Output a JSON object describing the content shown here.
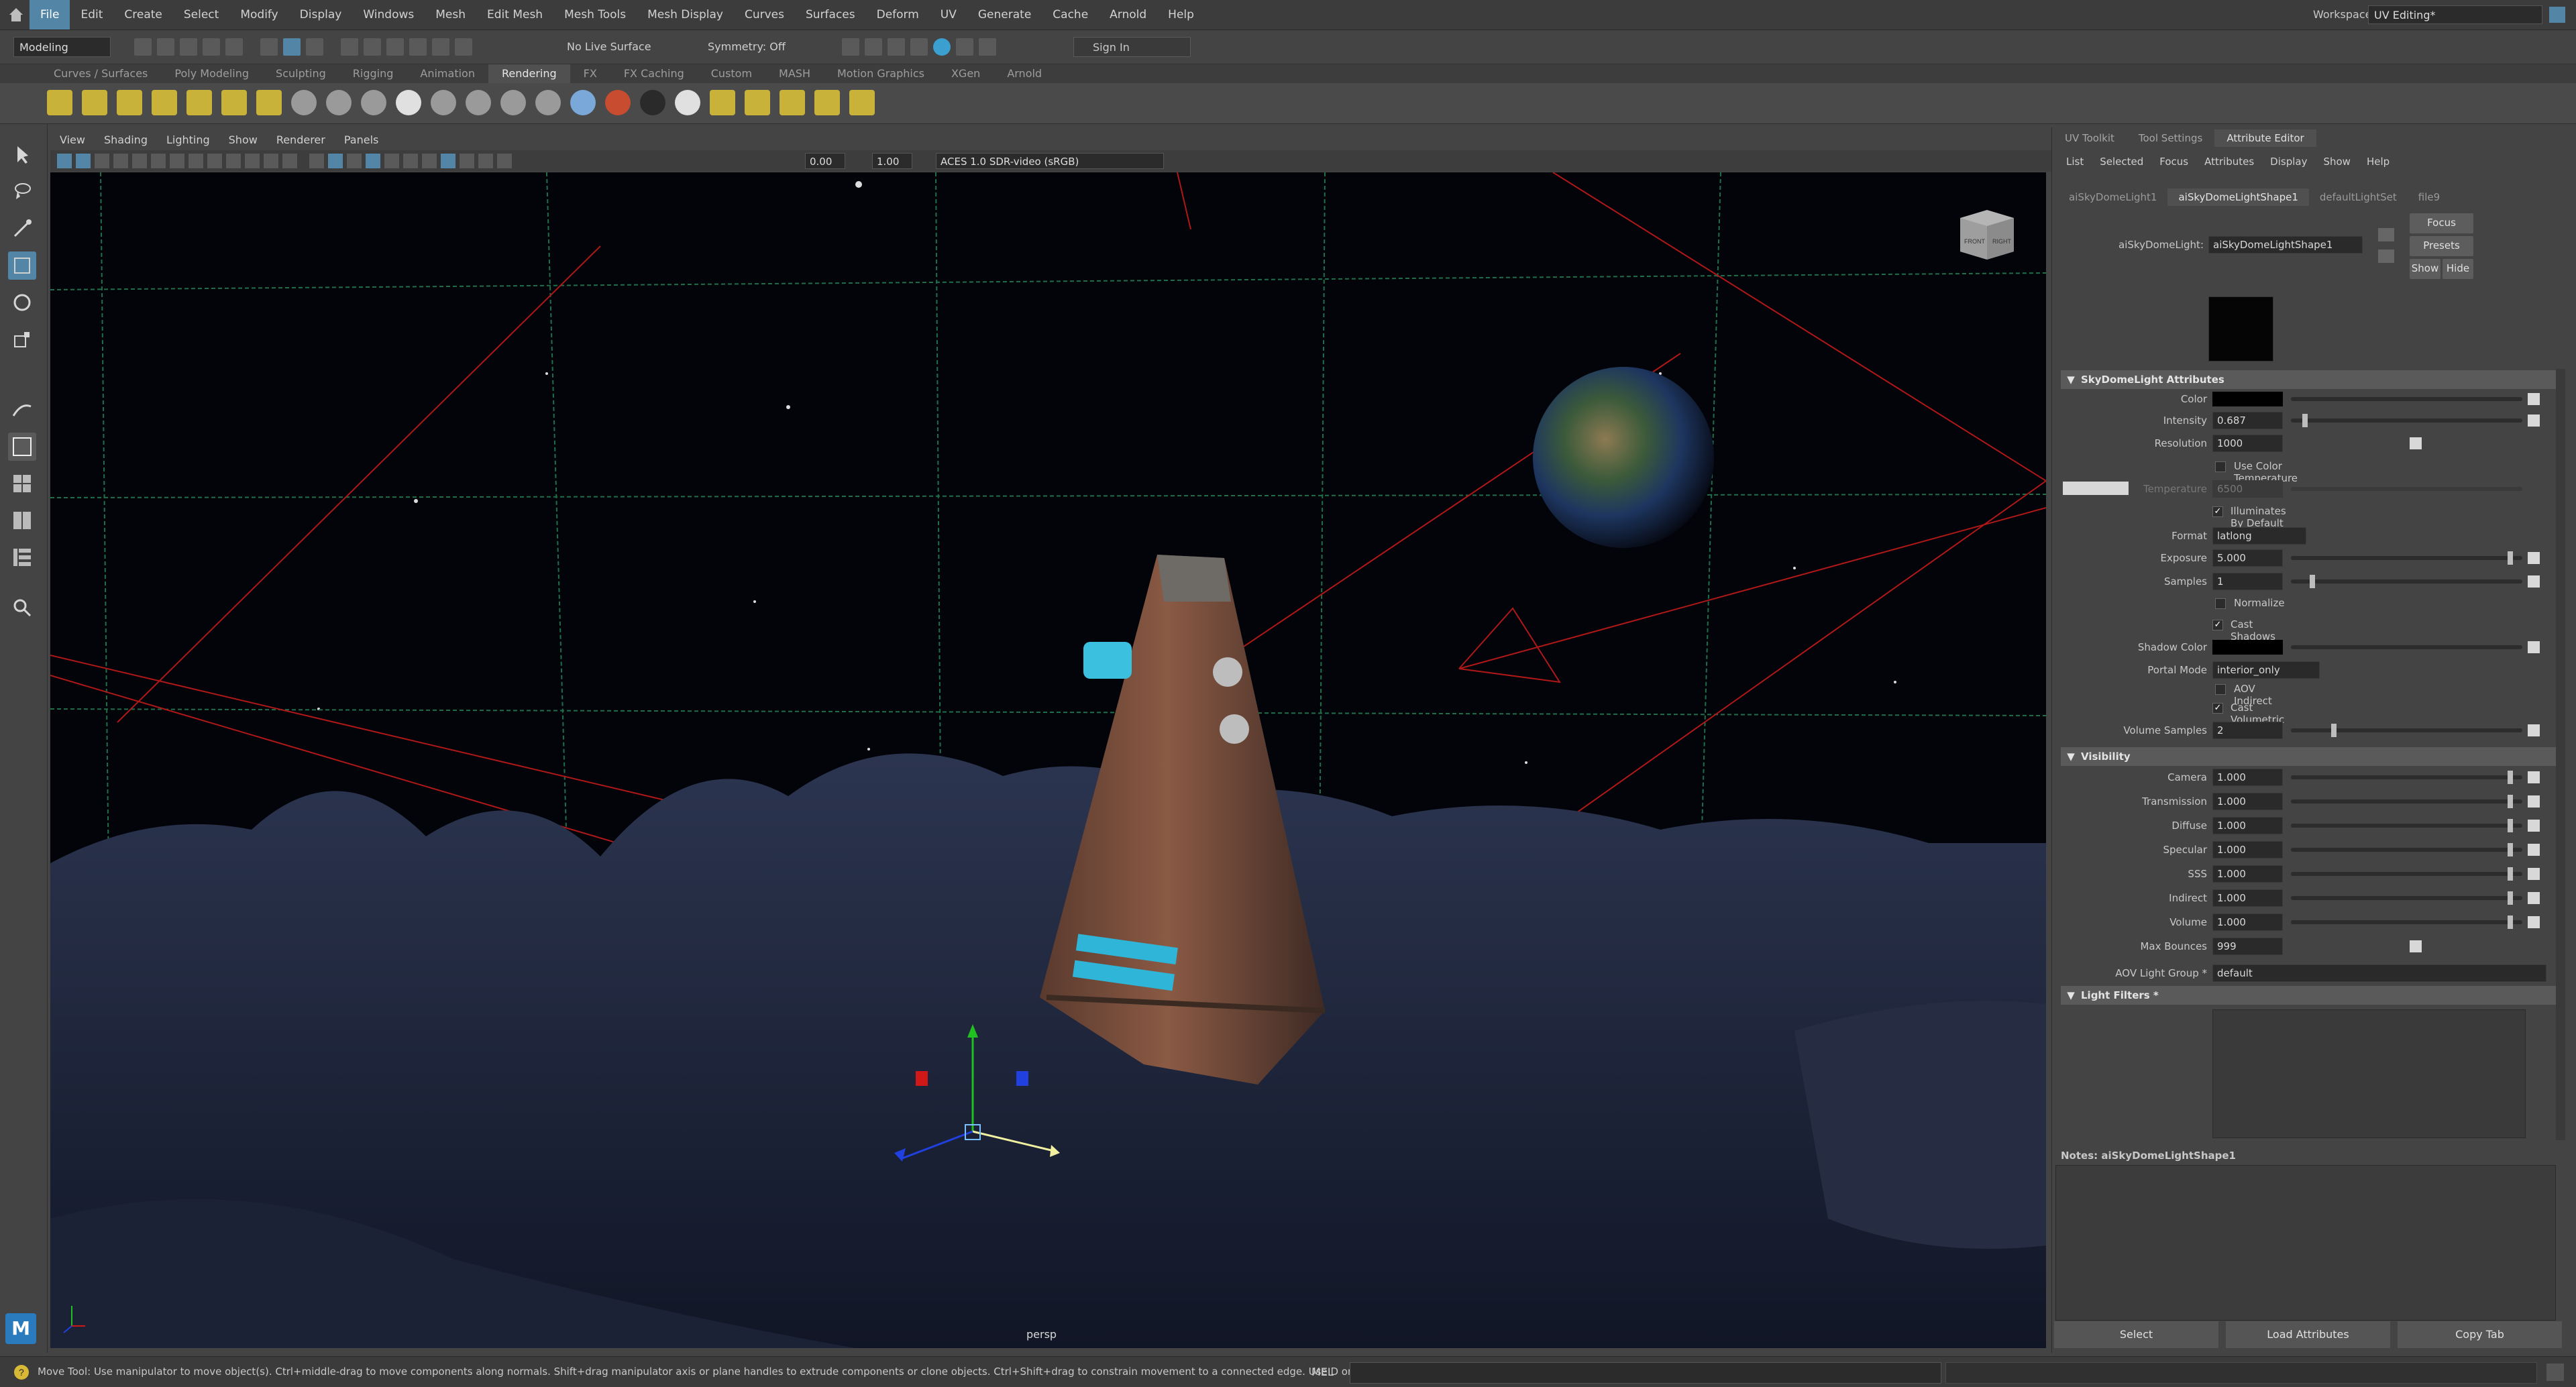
{
  "menubar": {
    "items": [
      "File",
      "Edit",
      "Create",
      "Select",
      "Modify",
      "Display",
      "Windows",
      "Mesh",
      "Edit Mesh",
      "Mesh Tools",
      "Mesh Display",
      "Curves",
      "Surfaces",
      "Deform",
      "UV",
      "Generate",
      "Cache",
      "Arnold",
      "Help"
    ],
    "active": "File",
    "workspace_label": "Workspace:",
    "workspace_value": "UV Editing*"
  },
  "statusline": {
    "mode": "Modeling",
    "live_surface": "No Live Surface",
    "symmetry": "Symmetry: Off",
    "sign_in": "Sign In"
  },
  "shelf": {
    "tabs": [
      "Curves / Surfaces",
      "Poly Modeling",
      "Sculpting",
      "Rigging",
      "Animation",
      "Rendering",
      "FX",
      "FX Caching",
      "Custom",
      "MASH",
      "Motion Graphics",
      "XGen",
      "Arnold"
    ],
    "active_tab": "Rendering"
  },
  "viewport": {
    "menu": [
      "View",
      "Shading",
      "Lighting",
      "Show",
      "Renderer",
      "Panels"
    ],
    "exposure": "0.00",
    "gamma": "1.00",
    "color_transform": "ACES 1.0 SDR-video (sRGB)",
    "camera_label": "persp",
    "viewcube_front": "FRONT",
    "viewcube_right": "RIGHT"
  },
  "right_panel": {
    "tabs": [
      "UV Toolkit",
      "Tool Settings",
      "Attribute Editor"
    ],
    "active_tab": "Attribute Editor",
    "menu": [
      "List",
      "Selected",
      "Focus",
      "Attributes",
      "Display",
      "Show",
      "Help"
    ],
    "node_tabs": [
      "aiSkyDomeLight1",
      "aiSkyDomeLightShape1",
      "defaultLightSet",
      "file9"
    ],
    "active_node_tab": "aiSkyDomeLightShape1",
    "node_label": "aiSkyDomeLight:",
    "node_value": "aiSkyDomeLightShape1",
    "focus_button": "Focus",
    "presets_button": "Presets",
    "show_button": "Show",
    "hide_button": "Hide",
    "section_skydome": "SkyDomeLight Attributes",
    "color_label": "Color",
    "intensity_label": "Intensity",
    "intensity_value": "0.687",
    "resolution_label": "Resolution",
    "resolution_value": "1000",
    "use_color_temp": "Use Color Temperature",
    "temperature_label": "Temperature",
    "temperature_value": "6500",
    "illuminates": "Illuminates By Default",
    "format_label": "Format",
    "format_value": "latlong",
    "exposure_label": "Exposure",
    "exposure_value": "5.000",
    "samples_label": "Samples",
    "samples_value": "1",
    "normalize": "Normalize",
    "cast_shadows": "Cast Shadows",
    "shadow_color_label": "Shadow Color",
    "portal_mode_label": "Portal Mode",
    "portal_mode_value": "interior_only",
    "aov_indirect": "AOV Indirect",
    "cast_vol_shadows": "Cast Volumetric Shadows",
    "volume_samples_label": "Volume Samples",
    "volume_samples_value": "2",
    "section_visibility": "Visibility",
    "visibility": [
      {
        "label": "Camera",
        "value": "1.000"
      },
      {
        "label": "Transmission",
        "value": "1.000"
      },
      {
        "label": "Diffuse",
        "value": "1.000"
      },
      {
        "label": "Specular",
        "value": "1.000"
      },
      {
        "label": "SSS",
        "value": "1.000"
      },
      {
        "label": "Indirect",
        "value": "1.000"
      },
      {
        "label": "Volume",
        "value": "1.000"
      }
    ],
    "max_bounces_label": "Max Bounces",
    "max_bounces_value": "999",
    "aov_group_label": "AOV Light Group *",
    "aov_group_value": "default",
    "section_light_filters": "Light Filters *",
    "notes_label": "Notes:  aiSkyDomeLightShape1",
    "select_button": "Select",
    "load_attrs_button": "Load Attributes",
    "copy_tab_button": "Copy Tab"
  },
  "helpline": {
    "text": "Move Tool: Use manipulator to move object(s). Ctrl+middle-drag to move components along normals. Shift+drag manipulator axis or plane handles to extrude components or clone objects. Ctrl+Shift+drag to constrain movement to a connected edge. Use D or INSERT to change",
    "mel_label": "MEL"
  },
  "colors": {
    "accent": "#5285a6",
    "viewport_bg": "#02040a",
    "grid": "#1f6f4a",
    "red_lines": "#b01818"
  }
}
